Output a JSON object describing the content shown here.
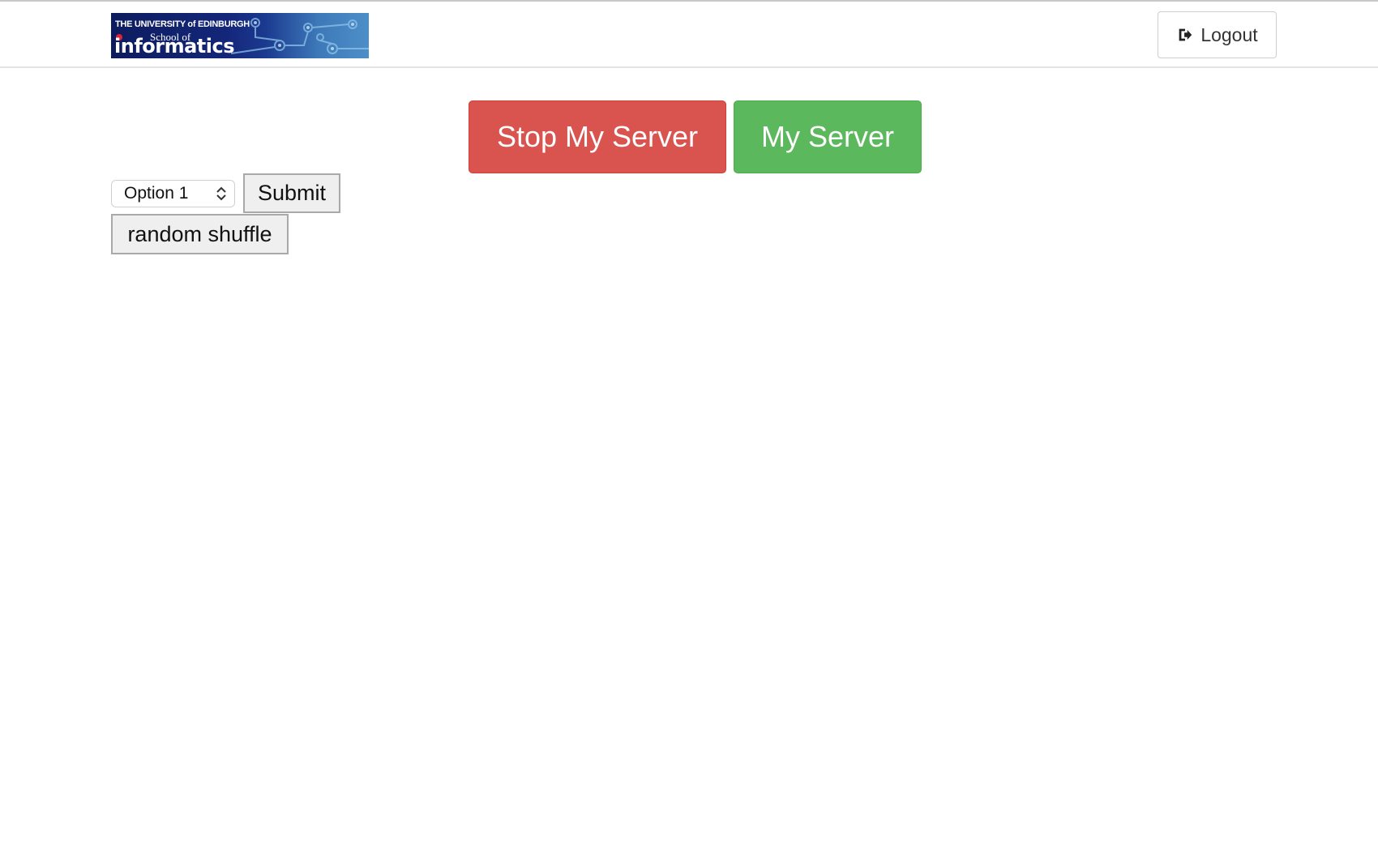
{
  "header": {
    "logo": {
      "line1": "THE UNIVERSITY of EDINBURGH",
      "line2": "School of",
      "line3": "informatics"
    },
    "logout_label": "Logout",
    "logout_icon": "sign-out-icon"
  },
  "server_controls": {
    "stop_label": "Stop My Server",
    "stop_color": "#d9534f",
    "my_server_label": "My Server",
    "my_server_color": "#5cb85c"
  },
  "form": {
    "select_value": "Option 1",
    "select_icon": "chevron-up-down-icon",
    "submit_label": "Submit",
    "shuffle_label": "random shuffle"
  }
}
